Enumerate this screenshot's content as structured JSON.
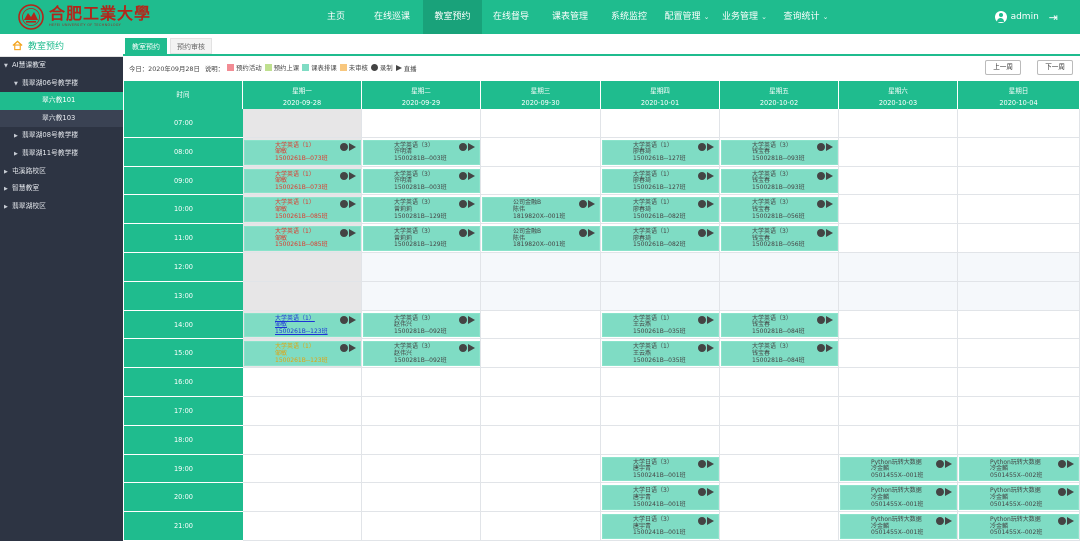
{
  "app": {
    "logo_cn": "合肥工業大學",
    "logo_en": "HEFEI UNIVERSITY OF TECHNOLOGY",
    "user": "admin"
  },
  "nav": [
    {
      "label": "主页",
      "active": false,
      "dropdown": false
    },
    {
      "label": "在线巡课",
      "active": false,
      "dropdown": false
    },
    {
      "label": "教室预约",
      "active": true,
      "dropdown": false
    },
    {
      "label": "在线督导",
      "active": false,
      "dropdown": false
    },
    {
      "label": "课表管理",
      "active": false,
      "dropdown": false
    },
    {
      "label": "系统监控",
      "active": false,
      "dropdown": false
    },
    {
      "label": "配置管理",
      "active": false,
      "dropdown": true
    },
    {
      "label": "业务管理",
      "active": false,
      "dropdown": true
    },
    {
      "label": "查询统计",
      "active": false,
      "dropdown": true
    }
  ],
  "sidebar": {
    "title": "教室预约",
    "items": [
      {
        "label": "AI慧课教室",
        "level": 0,
        "arrow": "down",
        "selected": false
      },
      {
        "label": "翡翠湖06号教学楼",
        "level": 1,
        "arrow": "down",
        "selected": false
      },
      {
        "label": "翠六教101",
        "level": 2,
        "arrow": "",
        "selected": true
      },
      {
        "label": "翠六教103",
        "level": 2,
        "arrow": "",
        "selected": false
      },
      {
        "label": "翡翠湖08号教学楼",
        "level": 1,
        "arrow": "right",
        "selected": false
      },
      {
        "label": "翡翠湖11号教学楼",
        "level": 1,
        "arrow": "right",
        "selected": false
      },
      {
        "label": "屯溪路校区",
        "level": 0,
        "arrow": "right",
        "selected": false
      },
      {
        "label": "智慧教室",
        "level": 0,
        "arrow": "right",
        "selected": false
      },
      {
        "label": "翡翠湖校区",
        "level": 0,
        "arrow": "right",
        "selected": false
      }
    ]
  },
  "tabs": [
    {
      "label": "教室预约",
      "active": true
    },
    {
      "label": "预约审核",
      "active": false
    }
  ],
  "toolbar": {
    "today": "今日：2020年09月28日",
    "note": "说明：",
    "legend": [
      {
        "label": "预约活动",
        "color": "#f28c94",
        "kind": "swatch"
      },
      {
        "label": "预约上课",
        "color": "#bfe08f",
        "kind": "swatch"
      },
      {
        "label": "课表排课",
        "color": "#7fdcc4",
        "kind": "swatch"
      },
      {
        "label": "未审核",
        "color": "#f8c77e",
        "kind": "swatch"
      },
      {
        "label": "录制",
        "color": "#444444",
        "kind": "dot"
      },
      {
        "label": "直播",
        "color": "#444444",
        "kind": "tri"
      }
    ],
    "prev_week": "上一周",
    "next_week": "下一周"
  },
  "schedule": {
    "time_header": "时间",
    "days": [
      {
        "name": "星期一",
        "date": "2020-09-28"
      },
      {
        "name": "星期二",
        "date": "2020-09-29"
      },
      {
        "name": "星期三",
        "date": "2020-09-30"
      },
      {
        "name": "星期四",
        "date": "2020-10-01"
      },
      {
        "name": "星期五",
        "date": "2020-10-02"
      },
      {
        "name": "星期六",
        "date": "2020-10-03"
      },
      {
        "name": "星期日",
        "date": "2020-10-04"
      }
    ],
    "times": [
      "07:00",
      "08:00",
      "09:00",
      "10:00",
      "11:00",
      "12:00",
      "13:00",
      "14:00",
      "15:00",
      "16:00",
      "17:00",
      "18:00",
      "19:00",
      "20:00",
      "21:00"
    ],
    "entries": [
      {
        "day": 0,
        "slot": 1,
        "lines": [
          "大学英语（1）",
          "邹敏",
          "1500261B--073班"
        ],
        "style": "red"
      },
      {
        "day": 0,
        "slot": 2,
        "lines": [
          "大学英语（1）",
          "邹敏",
          "1500261B--073班"
        ],
        "style": "red"
      },
      {
        "day": 0,
        "slot": 3,
        "lines": [
          "大学英语（1）",
          "邹敏",
          "1500261B--085班"
        ],
        "style": "red"
      },
      {
        "day": 0,
        "slot": 4,
        "lines": [
          "大学英语（1）",
          "邹敏",
          "1500261B--085班"
        ],
        "style": "red"
      },
      {
        "day": 0,
        "slot": 7,
        "lines": [
          "大学英语（1）",
          "邹敏",
          "1500261B--123班"
        ],
        "style": "blue"
      },
      {
        "day": 0,
        "slot": 8,
        "lines": [
          "大学英语（1）",
          "邹敏",
          "1500261B--123班"
        ],
        "style": "yellow"
      },
      {
        "day": 1,
        "slot": 1,
        "lines": [
          "大学英语（3）",
          "许明清",
          "1500281B--003班"
        ],
        "style": "normal"
      },
      {
        "day": 1,
        "slot": 2,
        "lines": [
          "大学英语（3）",
          "许明清",
          "1500281B--003班"
        ],
        "style": "normal"
      },
      {
        "day": 1,
        "slot": 3,
        "lines": [
          "大学英语（3）",
          "曾莉莉",
          "1500281B--129班"
        ],
        "style": "normal"
      },
      {
        "day": 1,
        "slot": 4,
        "lines": [
          "大学英语（3）",
          "曾莉莉",
          "1500281B--129班"
        ],
        "style": "normal"
      },
      {
        "day": 1,
        "slot": 7,
        "lines": [
          "大学英语（3）",
          "赵伟兴",
          "1500281B--092班"
        ],
        "style": "normal"
      },
      {
        "day": 1,
        "slot": 8,
        "lines": [
          "大学英语（3）",
          "赵伟兴",
          "1500281B--092班"
        ],
        "style": "normal"
      },
      {
        "day": 2,
        "slot": 3,
        "lines": [
          "公司金融B",
          "陈伟",
          "1819820X--001班"
        ],
        "style": "normal"
      },
      {
        "day": 2,
        "slot": 4,
        "lines": [
          "公司金融B",
          "陈伟",
          "1819820X--001班"
        ],
        "style": "normal"
      },
      {
        "day": 3,
        "slot": 1,
        "lines": [
          "大学英语（1）",
          "廖春琦",
          "1500261B--127班"
        ],
        "style": "normal"
      },
      {
        "day": 3,
        "slot": 2,
        "lines": [
          "大学英语（1）",
          "廖春琦",
          "1500261B--127班"
        ],
        "style": "normal"
      },
      {
        "day": 3,
        "slot": 3,
        "lines": [
          "大学英语（1）",
          "廖春琦",
          "1500261B--082班"
        ],
        "style": "normal"
      },
      {
        "day": 3,
        "slot": 4,
        "lines": [
          "大学英语（1）",
          "廖春琦",
          "1500261B--082班"
        ],
        "style": "normal"
      },
      {
        "day": 3,
        "slot": 7,
        "lines": [
          "大学英语（1）",
          "王云燕",
          "1500261B--035班"
        ],
        "style": "normal"
      },
      {
        "day": 3,
        "slot": 8,
        "lines": [
          "大学英语（1）",
          "王云燕",
          "1500261B--035班"
        ],
        "style": "normal"
      },
      {
        "day": 3,
        "slot": 12,
        "lines": [
          "大学日语（3）",
          "唐宇青",
          "1500241B--001班"
        ],
        "style": "normal"
      },
      {
        "day": 3,
        "slot": 13,
        "lines": [
          "大学日语（3）",
          "唐宇青",
          "1500241B--001班"
        ],
        "style": "normal"
      },
      {
        "day": 3,
        "slot": 14,
        "lines": [
          "大学日语（3）",
          "唐宇青",
          "1500241B--001班"
        ],
        "style": "normal"
      },
      {
        "day": 4,
        "slot": 1,
        "lines": [
          "大学英语（3）",
          "钱宝春",
          "1500281B--093班"
        ],
        "style": "normal"
      },
      {
        "day": 4,
        "slot": 2,
        "lines": [
          "大学英语（3）",
          "钱宝春",
          "1500281B--093班"
        ],
        "style": "normal"
      },
      {
        "day": 4,
        "slot": 3,
        "lines": [
          "大学英语（3）",
          "钱宝春",
          "1500281B--056班"
        ],
        "style": "normal"
      },
      {
        "day": 4,
        "slot": 4,
        "lines": [
          "大学英语（3）",
          "钱宝春",
          "1500281B--056班"
        ],
        "style": "normal"
      },
      {
        "day": 4,
        "slot": 7,
        "lines": [
          "大学英语（3）",
          "钱宝春",
          "1500281B--084班"
        ],
        "style": "normal"
      },
      {
        "day": 4,
        "slot": 8,
        "lines": [
          "大学英语（3）",
          "钱宝春",
          "1500281B--084班"
        ],
        "style": "normal"
      },
      {
        "day": 5,
        "slot": 12,
        "lines": [
          "Python玩转大数据",
          "冷金麟",
          "0501455X--001班"
        ],
        "style": "normal"
      },
      {
        "day": 5,
        "slot": 13,
        "lines": [
          "Python玩转大数据",
          "冷金麟",
          "0501455X--001班"
        ],
        "style": "normal"
      },
      {
        "day": 5,
        "slot": 14,
        "lines": [
          "Python玩转大数据",
          "冷金麟",
          "0501455X--001班"
        ],
        "style": "normal"
      },
      {
        "day": 6,
        "slot": 12,
        "lines": [
          "Python玩转大数据",
          "冷金麟",
          "0501455X--002班"
        ],
        "style": "normal"
      },
      {
        "day": 6,
        "slot": 13,
        "lines": [
          "Python玩转大数据",
          "冷金麟",
          "0501455X--002班"
        ],
        "style": "normal"
      },
      {
        "day": 6,
        "slot": 14,
        "lines": [
          "Python玩转大数据",
          "冷金麟",
          "0501455X--002班"
        ],
        "style": "normal"
      }
    ]
  }
}
